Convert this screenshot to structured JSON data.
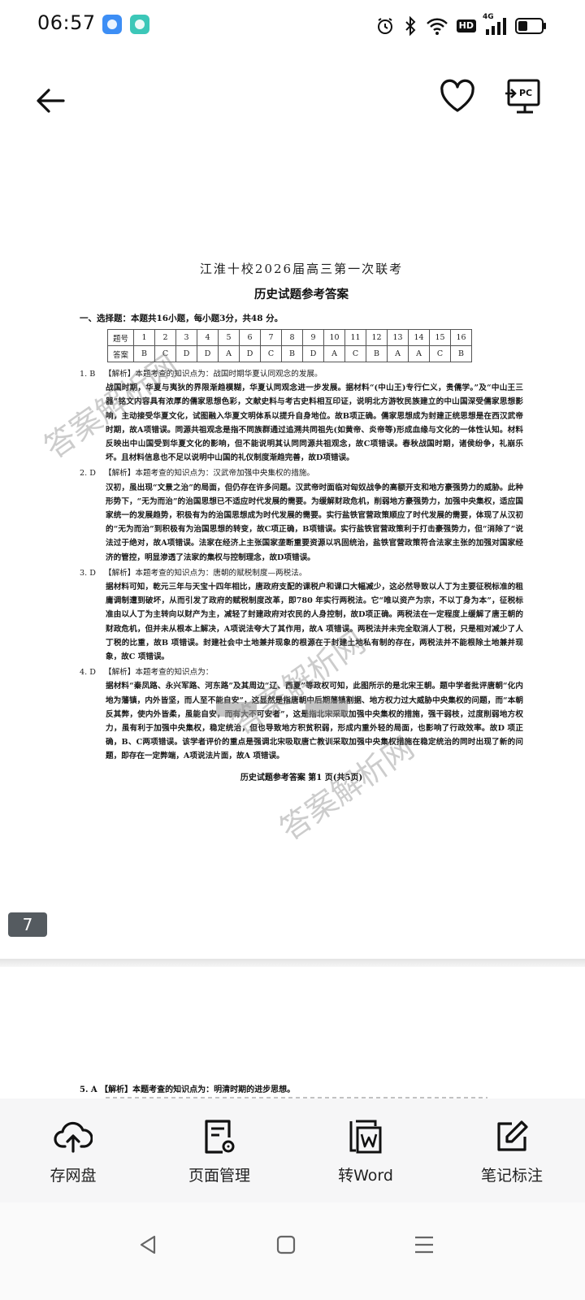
{
  "status_bar": {
    "time": "06:57",
    "hd_label": "HD",
    "network_label": "4G",
    "icons": [
      "cloud-app-icon",
      "chat-app-icon",
      "alarm-icon",
      "bluetooth-icon",
      "wifi-icon",
      "hd-icon",
      "signal-icon",
      "battery-icon"
    ]
  },
  "header": {
    "back_icon": "arrow-left-icon",
    "favorite_icon": "heart-icon",
    "pc_icon": "pc-screen-icon",
    "pc_label": "PC"
  },
  "document": {
    "school": "江淮十校2026届高三第一次联考",
    "title": "历史试题参考答案",
    "section": "一、选择题：本题共16小题，每小题3分，共48 分。",
    "table": {
      "row1_head": "题号",
      "row2_head": "答案",
      "numbers": [
        "1",
        "2",
        "3",
        "4",
        "5",
        "6",
        "7",
        "8",
        "9",
        "10",
        "11",
        "12",
        "13",
        "14",
        "15",
        "16"
      ],
      "answers": [
        "B",
        "C",
        "D",
        "D",
        "A",
        "D",
        "C",
        "B",
        "D",
        "A",
        "C",
        "B",
        "A",
        "A",
        "C",
        "B"
      ]
    },
    "questions": [
      {
        "num": "1. B",
        "head": "【解析】本题考查的知识点为：战国时期华夏认同观念的发展。",
        "body": "战国时期，华夏与夷狄的界限渐趋模糊，华夏认同观念进一步发展。据材料“(中山王)专行仁义，贵儒学。”及“中山王三器”铭文内容具有浓厚的儒家思想色彩，文献史料与考古史料相互印证，说明北方游牧民族建立的中山国深受儒家思想影响，主动接受华夏文化，试图融入华夏文明体系以提升自身地位。故B项正确。儒家思想成为封建正统思想是在西汉武帝时期，故A项错误。同源共祖观念是指不同族群通过追溯共同祖先(如黄帝、炎帝等)形成血缘与文化的一体性认知。材料反映出中山国受到华夏文化的影响，但不能说明其认同同源共祖观念，故C项错误。春秋战国时期，诸侯纷争，礼崩乐坏。且材料信息也不足以说明中山国的礼仪制度渐趋完善，故D项错误。"
      },
      {
        "num": "2. D",
        "head": "【解析】本题考查的知识点为：汉武帝加强中央集权的措施。",
        "body": "汉初，虽出现“文景之治”的局面，但仍存在许多问题。汉武帝时面临对匈奴战争的高额开支和地方豪强势力的威胁。此种形势下，“无为而治”的治国思想已不适应时代发展的需要。为缓解财政危机，削弱地方豪强势力，加强中央集权，适应国家统一的发展趋势，积极有为的治国思想成为时代发展的需要。实行盐铁官营政策顺应了时代发展的需要，体现了从汉初的“无为而治”到积极有为治国思想的转变，故C项正确，B项错误。实行盐铁官营政策利于打击豪强势力，但“消除了”说法过于绝对，故A项错误。法家在经济上主张国家垄断重要资源以巩固统治，盐铁官营政策符合法家主张的加强对国家经济的管控，明显渗透了法家的集权与控制理念，故D项错误。"
      },
      {
        "num": "3. D",
        "head": "【解析】本题考查的知识点为：唐朝的赋税制度—两税法。",
        "body": "据材料可知，乾元三年与天宝十四年相比，唐政府支配的课税户和课口大幅减少，这必然导致以人丁为主要征税标准的租庸调制遭到破坏，从而引发了政府的赋税制度改革，即780 年实行两税法。它“唯以资产为宗，不以丁身为本”，征税标准由以人丁为主转向以财产为主，减轻了封建政府对农民的人身控制，故D项正确。两税法在一定程度上缓解了唐王朝的财政危机，但并未从根本上解决，A项说法夸大了其作用，故A 项错误。两税法并未完全取消人丁税，只是相对减少了人丁税的比重，故B 项错误。封建社会中土地兼并现象的根源在于封建土地私有制的存在，两税法并不能根除土地兼并现象，故C 项错误。"
      },
      {
        "num": "4. D",
        "head": "【解析】本题考查的知识点为：",
        "body": "据材料“秦凤路、永兴军路、河东路”及其周边“辽、西夏”等政权可知，此图所示的是北宋王朝。题中学者批评唐朝“化内地为藩镇，内外皆坚，而人至不能自安”，这显然是指唐朝中后期藩镇割据、地方权力过大威胁中央集权的问题，而“本朝反其弊，使内外皆柔，虽能自安，而有大不可安者”，这是指北宋采取加强中央集权的措施，强干弱枝，过度削弱地方权力，虽有利于加强中央集权，稳定统治，但也导致地方积贫积弱，形成内重外轻的局面，也影响了行政效率。故D 项正确，B、C两项错误。该学者评价的重点是强调北宋吸取唐亡教训采取加强中央集权措施在稳定统治的同时出现了新的问题，即存在一定弊端，A项说法片面，故A 项错误。"
      }
    ],
    "footer": "历史试题参考答案 第1 页(共5页)",
    "watermark": "答案解析网",
    "page_number": "7",
    "next_page_line": "5. A 【解析】本题考查的知识点为：明清时期的进步思想。"
  },
  "toolbar": {
    "items": [
      {
        "label": "存网盘",
        "icon": "cloud-upload-icon"
      },
      {
        "label": "页面管理",
        "icon": "page-settings-icon"
      },
      {
        "label": "转Word",
        "icon": "word-convert-icon"
      },
      {
        "label": "笔记标注",
        "icon": "edit-note-icon"
      }
    ]
  },
  "nav": {
    "back": "nav-back-icon",
    "home": "nav-home-icon",
    "menu": "nav-menu-icon"
  }
}
